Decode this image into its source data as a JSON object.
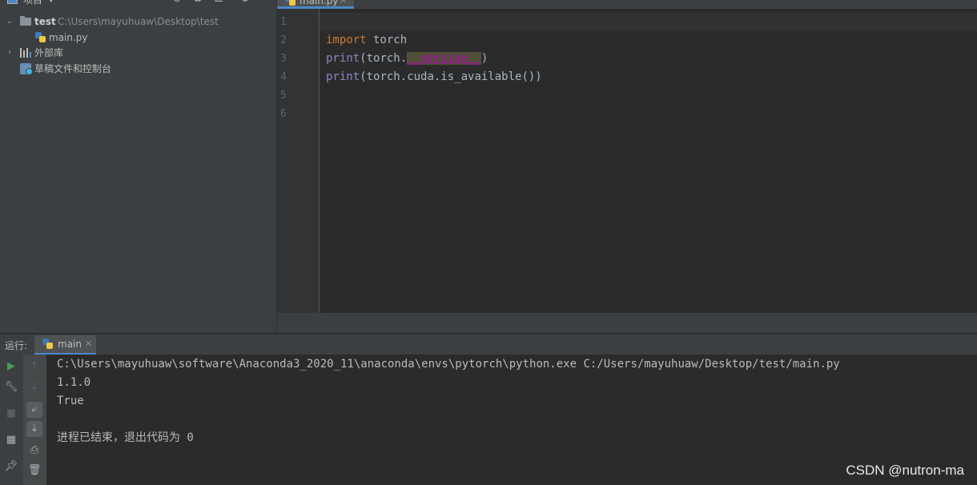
{
  "project_panel": {
    "title": "项目",
    "tree": [
      {
        "label": "test",
        "path": "C:\\Users\\mayuhuaw\\Desktop\\test"
      },
      {
        "label": "main.py"
      },
      {
        "label": "外部库"
      },
      {
        "label": "草稿文件和控制台"
      }
    ]
  },
  "editor": {
    "tab_label": "main.py",
    "line_numbers": [
      "1",
      "2",
      "3",
      "4",
      "5",
      "6"
    ],
    "code": {
      "line2": {
        "kw": "import",
        "rest": " torch"
      },
      "line3": {
        "fn": "print",
        "pre": "(torch.",
        "dunder": "__version__",
        "post": ")"
      },
      "line4": {
        "fn": "print",
        "rest": "(torch.cuda.is_available())"
      }
    }
  },
  "run_panel": {
    "label": "运行:",
    "tab_label": "main",
    "console_lines": [
      "C:\\Users\\mayuhuaw\\software\\Anaconda3_2020_11\\anaconda\\envs\\pytorch\\python.exe C:/Users/mayuhuaw/Desktop/test/main.py",
      "1.1.0",
      "True",
      "",
      "进程已结束，退出代码为 0"
    ]
  },
  "watermark": "CSDN @nutron-ma",
  "colors": {
    "panel_bg": "#3c3f41",
    "editor_bg": "#2b2b2b",
    "keyword": "#cc7832",
    "builtin": "#8888c6",
    "dunder": "#b200b2",
    "accent": "#4a88c7",
    "run_green": "#499c54"
  },
  "icons": [
    "project-icon",
    "dropdown-icon",
    "locate-icon",
    "collapse-all-icon",
    "expand-all-icon",
    "gear-icon",
    "minimize-icon",
    "folder-icon",
    "python-file-icon",
    "library-icon",
    "scratch-icon",
    "run-icon",
    "wrench-icon",
    "stop-icon",
    "layout-icon",
    "pin-icon",
    "up-arrow-icon",
    "down-arrow-icon",
    "soft-wrap-icon",
    "scroll-to-end-icon",
    "print-icon",
    "trash-icon",
    "close-icon",
    "chevron-down-icon",
    "chevron-right-icon"
  ]
}
